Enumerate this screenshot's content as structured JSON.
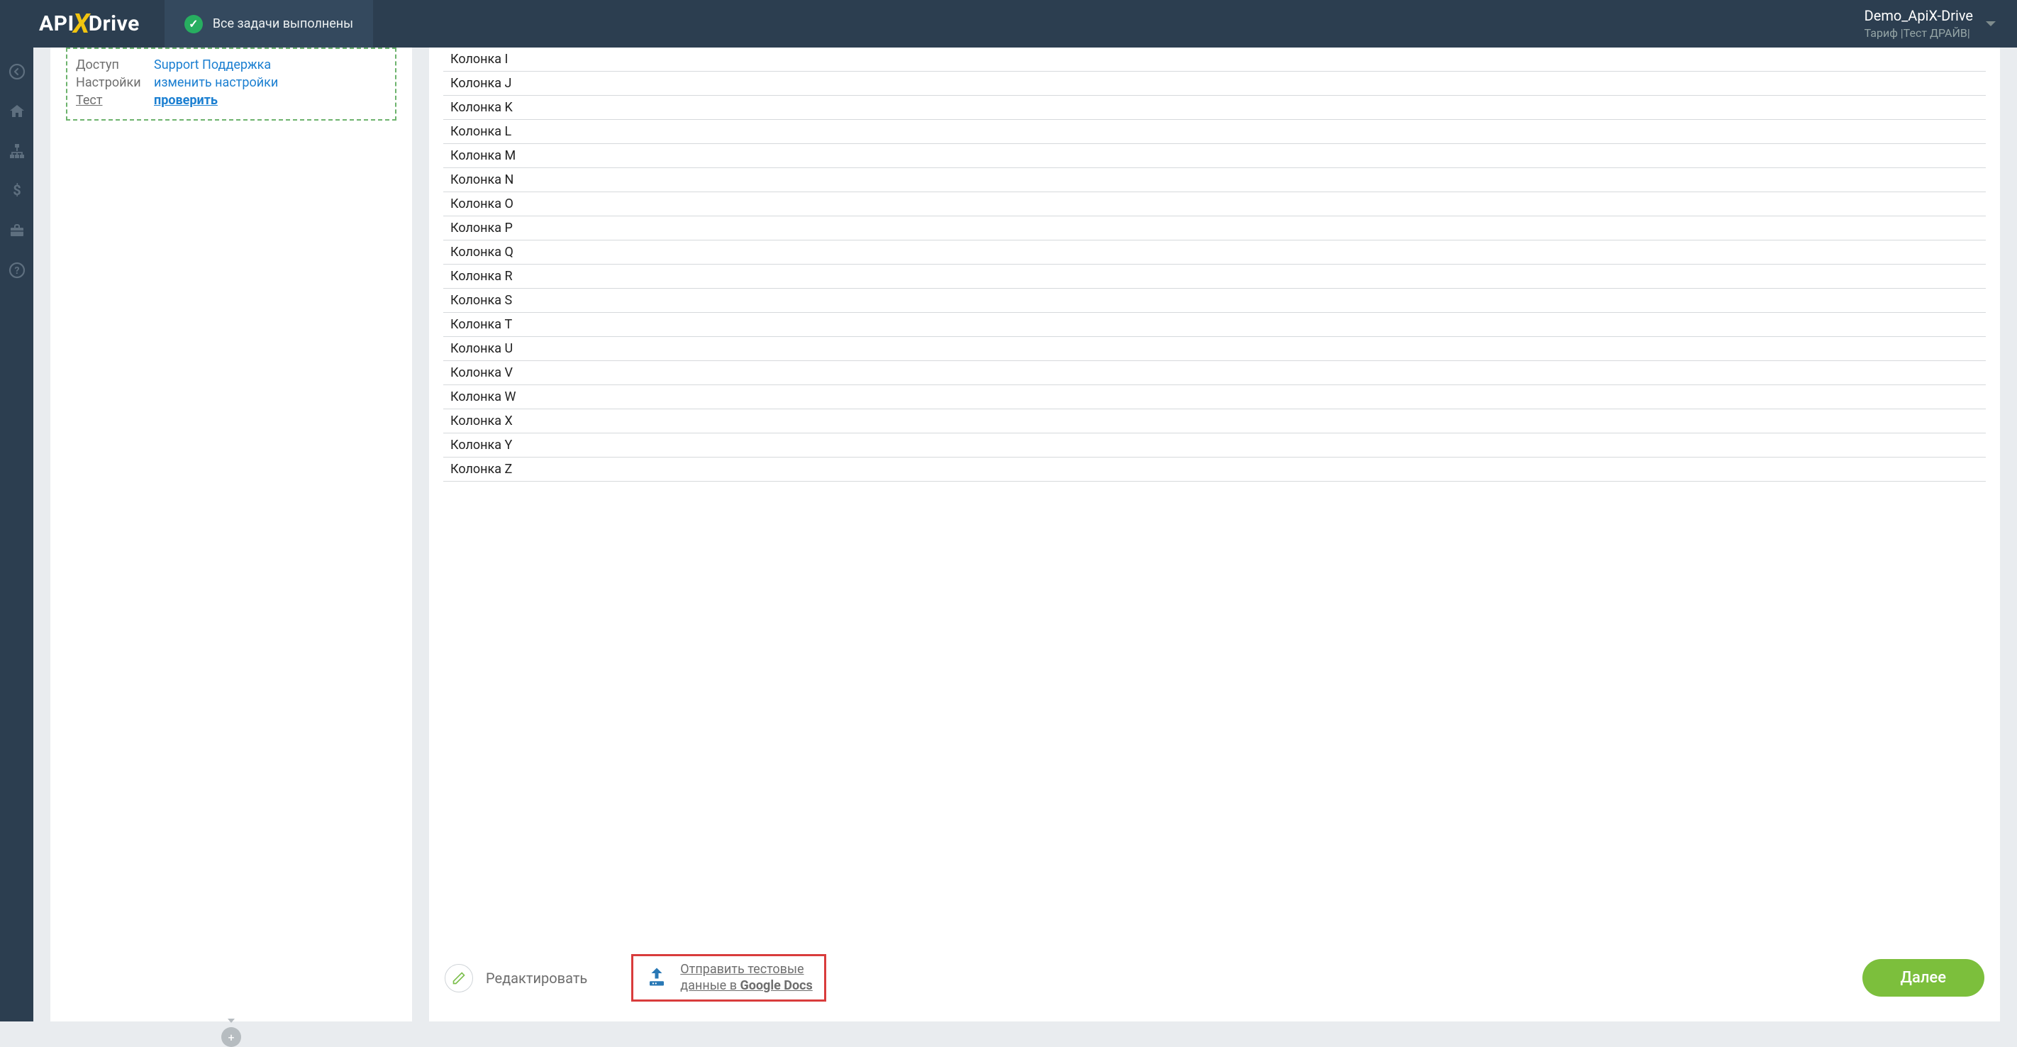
{
  "header": {
    "status_text": "Все задачи выполнены",
    "account_name": "Demo_ApiX-Drive",
    "account_plan": "Тариф |Тест ДРАЙВ|"
  },
  "config_card": {
    "rows": [
      {
        "label": "Доступ",
        "value": "Support Поддержка",
        "label_underline": false,
        "value_bold": false
      },
      {
        "label": "Настройки",
        "value": "изменить настройки",
        "label_underline": false,
        "value_bold": false
      },
      {
        "label": "Тест",
        "value": "проверить",
        "label_underline": true,
        "value_bold": true
      }
    ]
  },
  "columns": [
    "Колонка I",
    "Колонка J",
    "Колонка K",
    "Колонка L",
    "Колонка M",
    "Колонка N",
    "Колонка O",
    "Колонка P",
    "Колонка Q",
    "Колонка R",
    "Колонка S",
    "Колонка T",
    "Колонка U",
    "Колонка V",
    "Колонка W",
    "Колонка X",
    "Колонка Y",
    "Колонка Z"
  ],
  "actions": {
    "edit_label": "Редактировать",
    "send_line1": "Отправить тестовые",
    "send_line2_prefix": "данные в ",
    "send_line2_bold": "Google Docs",
    "next_label": "Далее"
  },
  "logo": {
    "part1": "API",
    "part2": "X",
    "part3": "Drive"
  }
}
